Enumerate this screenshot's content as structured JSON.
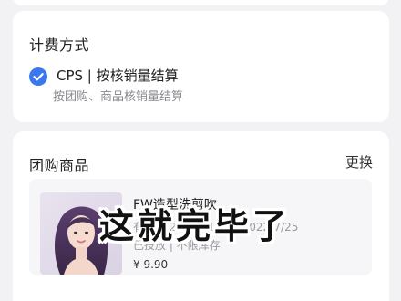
{
  "billing": {
    "title": "计费方式",
    "option_label": "CPS | 按核销量结算",
    "option_desc": "按团购、商品核销量结算"
  },
  "product_section": {
    "title": "团购商品",
    "change_label": "更换",
    "product": {
      "name": "FW造型洗剪吹",
      "meta": "有效期 2021-11-1 ~ 2022-7/25",
      "note": "已投放 | 不限库存",
      "price": "¥ 9.90"
    }
  },
  "overlay": {
    "caption": "这就完毕了"
  },
  "colors": {
    "accent": "#3b78f0",
    "background": "#f2f2f4",
    "card": "#ffffff",
    "product_box": "#f6f6f8"
  }
}
